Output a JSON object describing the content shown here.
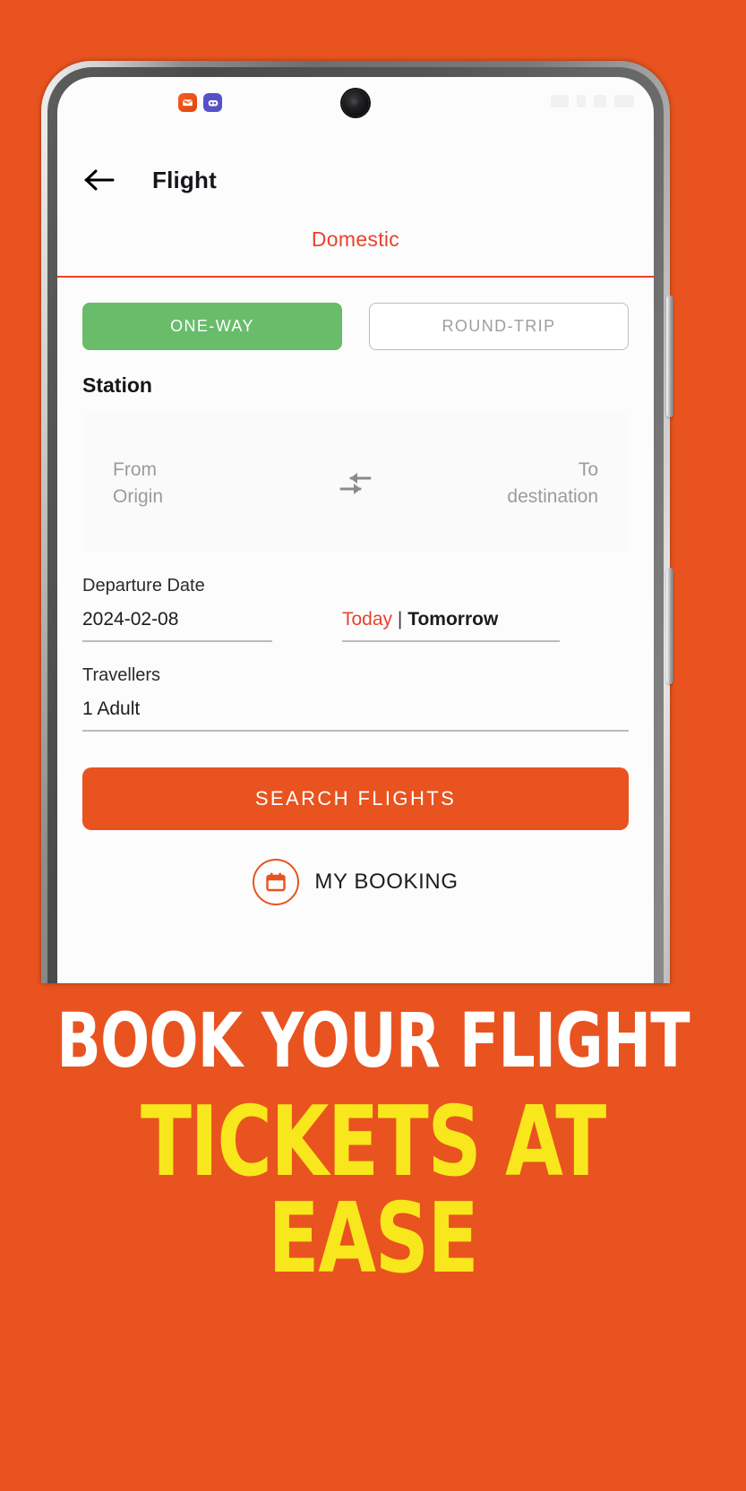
{
  "background_color": "#e9531f",
  "status_bar": {
    "app_icons": [
      {
        "name": "notification-app-orange",
        "glyph": "✉",
        "color": "#f4611f"
      },
      {
        "name": "notification-app-purple",
        "glyph": "◉◉",
        "color": "#5551c9"
      }
    ],
    "system_icons": [
      "wifi-icon",
      "signal-icon",
      "signal-icon",
      "battery-icon"
    ]
  },
  "header": {
    "back_icon": "back-arrow-icon",
    "title": "Flight"
  },
  "tabs": [
    {
      "label": "Domestic",
      "active": true,
      "color": "#e8432c"
    }
  ],
  "trip_type": {
    "one_way": "ONE-WAY",
    "round_trip": "ROUND-TRIP",
    "active": "ONE-WAY",
    "active_color": "#68bc6a"
  },
  "station": {
    "label": "Station",
    "from_label": "From",
    "from_value": "Origin",
    "to_label": "To",
    "to_value": "destination",
    "swap_icon": "swap-arrows-icon"
  },
  "departure": {
    "label": "Departure Date",
    "value": "2024-02-08",
    "quick_today": "Today",
    "quick_separator": "|",
    "quick_tomorrow": "Tomorrow",
    "today_color": "#e8432c"
  },
  "travellers": {
    "label": "Travellers",
    "value": "1 Adult"
  },
  "actions": {
    "search_label": "SEARCH FLIGHTS",
    "search_color": "#e9531f",
    "booking_label": "MY BOOKING",
    "booking_icon": "calendar-icon"
  },
  "promo": {
    "line1": "BOOK YOUR FLIGHT",
    "line2": "TICKETS AT EASE",
    "line1_color": "#ffffff",
    "line2_color": "#f8e71c"
  }
}
